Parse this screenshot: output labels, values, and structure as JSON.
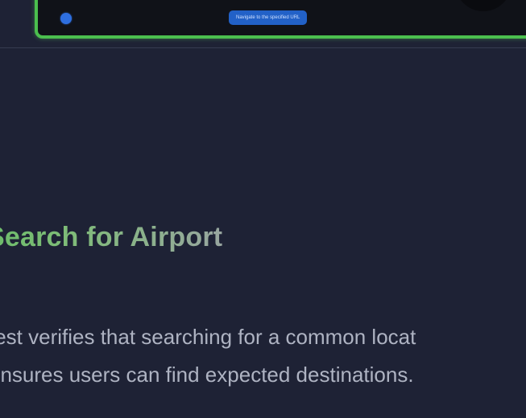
{
  "preview": {
    "tooltip_text": "Navigate to the specified URL",
    "accent_color": "#4bbf4e",
    "dot_color": "#2e6fe0"
  },
  "test": {
    "title": "Search for Airport",
    "description_line1": "test verifies that searching for a common locat",
    "description_line2": "ensures users can find expected destinations."
  },
  "colors": {
    "background": "#1e2235",
    "title_green": "#6cbc6a",
    "body_text": "#aeb3c2"
  }
}
